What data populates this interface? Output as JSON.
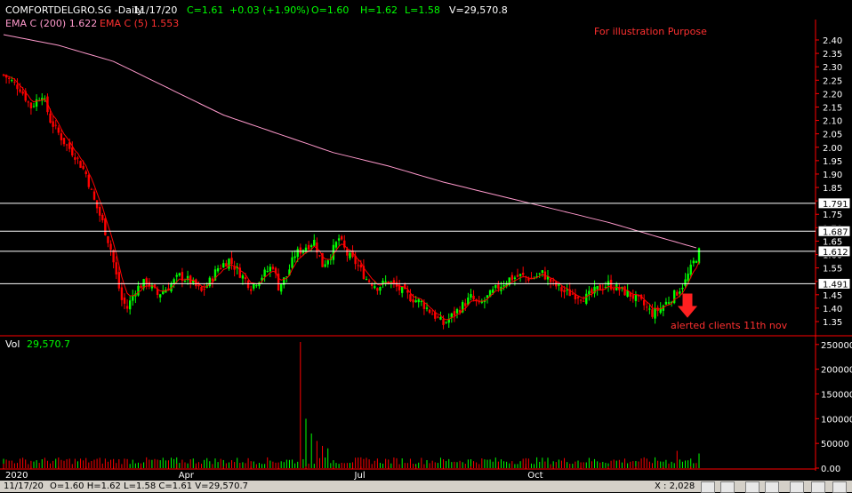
{
  "header": {
    "symbol": "COMFORTDELGRO.SG -Daily",
    "date": "11/17/20",
    "close": "C=1.61",
    "change": "+0.03 (+1.90%)",
    "open": "O=1.60",
    "high": "H=1.62",
    "low": "L=1.58",
    "volume": "V=29,570.8"
  },
  "ema_legend": {
    "ema200": "EMA C (200)  1.622",
    "ema5": "EMA C (5)  1.553"
  },
  "annotations": {
    "purpose": "For illustration Purpose",
    "alert": "alerted clients 11th nov"
  },
  "volume_header": {
    "label": "Vol",
    "value": "29,570.7"
  },
  "status_bar": {
    "date": "11/17/20",
    "ohlc": "O=1.60   H=1.62   L=1.58   C=1.61   V=29,570.7",
    "x_readout": "X : 2,028"
  },
  "colors": {
    "background": "#000000",
    "up_candle": "#00ff00",
    "down_candle": "#ff0000",
    "ema200": "#ff99cc",
    "ema5": "#ff0000",
    "level_lines": "#ffffff",
    "axis": "#ff0000",
    "header_value": "#00ff00"
  },
  "chart_data": [
    {
      "type": "candlestick",
      "title": "COMFORTDELGRO.SG -Daily",
      "x_tick_labels": [
        "2020",
        "Apr",
        "Jul",
        "Oct"
      ],
      "y_tick_labels": [
        "2.40",
        "2.35",
        "2.30",
        "2.25",
        "2.20",
        "2.15",
        "2.10",
        "2.05",
        "2.00",
        "1.95",
        "1.90",
        "1.85",
        "1.80",
        "1.75",
        "1.70",
        "1.65",
        "1.60",
        "1.55",
        "1.50",
        "1.45",
        "1.40",
        "1.35"
      ],
      "ylim": [
        1.3,
        2.42
      ],
      "horizontal_levels": [
        {
          "label": "1.791",
          "value": 1.791
        },
        {
          "label": "1.687",
          "value": 1.687
        },
        {
          "label": "1.612",
          "value": 1.612
        },
        {
          "label": "1.491",
          "value": 1.491
        }
      ],
      "price_path": [
        [
          0,
          2.27
        ],
        [
          6,
          2.22
        ],
        [
          10,
          2.15
        ],
        [
          14,
          2.2
        ],
        [
          17,
          2.1
        ],
        [
          22,
          2.02
        ],
        [
          26,
          1.97
        ],
        [
          30,
          1.9
        ],
        [
          33,
          1.8
        ],
        [
          36,
          1.72
        ],
        [
          39,
          1.62
        ],
        [
          41,
          1.52
        ],
        [
          43,
          1.43
        ],
        [
          45,
          1.4
        ],
        [
          48,
          1.47
        ],
        [
          52,
          1.5
        ],
        [
          56,
          1.45
        ],
        [
          60,
          1.48
        ],
        [
          64,
          1.52
        ],
        [
          68,
          1.5
        ],
        [
          72,
          1.46
        ],
        [
          75,
          1.5
        ],
        [
          78,
          1.55
        ],
        [
          82,
          1.58
        ],
        [
          86,
          1.53
        ],
        [
          90,
          1.48
        ],
        [
          94,
          1.52
        ],
        [
          98,
          1.56
        ],
        [
          100,
          1.48
        ],
        [
          103,
          1.52
        ],
        [
          106,
          1.6
        ],
        [
          110,
          1.63
        ],
        [
          113,
          1.65
        ],
        [
          116,
          1.56
        ],
        [
          119,
          1.6
        ],
        [
          122,
          1.66
        ],
        [
          125,
          1.6
        ],
        [
          128,
          1.57
        ],
        [
          132,
          1.51
        ],
        [
          136,
          1.48
        ],
        [
          140,
          1.5
        ],
        [
          144,
          1.47
        ],
        [
          148,
          1.44
        ],
        [
          152,
          1.42
        ],
        [
          156,
          1.38
        ],
        [
          160,
          1.34
        ],
        [
          163,
          1.37
        ],
        [
          166,
          1.4
        ],
        [
          170,
          1.44
        ],
        [
          173,
          1.41
        ],
        [
          176,
          1.44
        ],
        [
          180,
          1.48
        ],
        [
          184,
          1.51
        ],
        [
          188,
          1.52
        ],
        [
          192,
          1.51
        ],
        [
          196,
          1.53
        ],
        [
          200,
          1.49
        ],
        [
          204,
          1.46
        ],
        [
          208,
          1.45
        ],
        [
          212,
          1.44
        ],
        [
          216,
          1.47
        ],
        [
          220,
          1.49
        ],
        [
          224,
          1.47
        ],
        [
          228,
          1.45
        ],
        [
          232,
          1.42
        ],
        [
          236,
          1.38
        ],
        [
          239,
          1.4
        ],
        [
          242,
          1.43
        ],
        [
          245,
          1.46
        ],
        [
          248,
          1.5
        ],
        [
          251,
          1.57
        ],
        [
          253,
          1.61
        ]
      ],
      "ema200_path": [
        [
          0,
          2.42
        ],
        [
          20,
          2.38
        ],
        [
          40,
          2.32
        ],
        [
          60,
          2.22
        ],
        [
          80,
          2.12
        ],
        [
          100,
          2.05
        ],
        [
          120,
          1.98
        ],
        [
          140,
          1.93
        ],
        [
          160,
          1.87
        ],
        [
          180,
          1.82
        ],
        [
          200,
          1.77
        ],
        [
          220,
          1.72
        ],
        [
          240,
          1.66
        ],
        [
          253,
          1.622
        ]
      ]
    },
    {
      "type": "bar",
      "title": "Vol",
      "y_tick_labels": [
        "250000",
        "200000",
        "150000",
        "100000",
        "50000",
        "0.00"
      ],
      "ylim": [
        0,
        255000
      ],
      "peak_bars": [
        {
          "index": 108,
          "value": 255000
        },
        {
          "index": 110,
          "value": 100000
        },
        {
          "index": 112,
          "value": 70000
        },
        {
          "index": 114,
          "value": 55000
        },
        {
          "index": 116,
          "value": 45000
        },
        {
          "index": 118,
          "value": 40000
        },
        {
          "index": 245,
          "value": 35000
        },
        {
          "index": 253,
          "value": 29570.7
        }
      ],
      "baseline_range": [
        8000,
        22000
      ]
    }
  ]
}
